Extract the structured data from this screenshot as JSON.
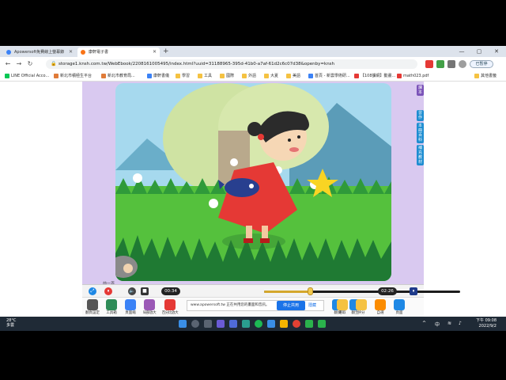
{
  "browser": {
    "tabs": [
      {
        "label": "Apowersoft免費線上螢幕錄",
        "favicon_color": "#3b82f6"
      },
      {
        "label": "康軒電子書",
        "favicon_color": "#f97316"
      }
    ],
    "new_tab": "+",
    "window_controls": [
      "—",
      "▢",
      "✕"
    ],
    "url": "storage1.knsh.com.tw/WebEbook/2208161005495/index.html?uuid=31188965-395d-41b0-a7af-61d2c6c07d38&openby=knsh",
    "pause_button": "已暫停",
    "bookmarks": [
      {
        "label": "LINE Official Acco...",
        "color": "#06c755"
      },
      {
        "label": "新北市積極生平台",
        "color": "#e07b39"
      },
      {
        "label": "新北市教育局...",
        "color": "#e07b39"
      },
      {
        "label": "康軒書儀",
        "color": "#3b82f6"
      },
      {
        "label": "學習",
        "color": "#f5c242"
      },
      {
        "label": "工具",
        "color": "#f5c242"
      },
      {
        "label": "國際",
        "color": "#f5c242"
      },
      {
        "label": "外語",
        "color": "#f5c242"
      },
      {
        "label": "大夏",
        "color": "#f5c242"
      },
      {
        "label": "美語",
        "color": "#f5c242"
      },
      {
        "label": "首頁 - 新雲學術研...",
        "color": "#3b82f6"
      },
      {
        "label": "【108課綱】動畫...",
        "color": "#e53935"
      },
      {
        "label": "math023.pdf",
        "color": "#e53935"
      },
      {
        "label": "其他書籤",
        "color": "#f5c242"
      }
    ]
  },
  "ebook": {
    "side_tabs": [
      "課本",
      "習作",
      "本冊百科",
      "補充教材"
    ],
    "prev_label": "前一頁",
    "player": {
      "current_time": "00:34",
      "total_time": "02:26",
      "progress": 0.233
    },
    "tools": [
      {
        "label": "翻頁設定",
        "color": "#555"
      },
      {
        "label": "工具箱",
        "color": "#2e8b57"
      },
      {
        "label": "頁面縮",
        "color": "#3b82f6"
      },
      {
        "label": "局部放大",
        "color": "#9b59b6"
      },
      {
        "label": "百分比放大",
        "color": "#e53935"
      },
      {
        "label": "翻頁",
        "color": "#1e88e5"
      },
      {
        "label": "翻至",
        "color": "#1e88e5"
      },
      {
        "label": "選取",
        "color": "#f5c242"
      },
      {
        "label": "評分",
        "color": "#f5c242"
      },
      {
        "label": "自選",
        "color": "#fb8c00"
      },
      {
        "label": "頁面",
        "color": "#1e88e5"
      }
    ],
    "notification": {
      "text": "www.apowersoft.tw 正在共用您的畫面和音訊。",
      "stop_label": "停止共用",
      "hide_label": "隱藏"
    }
  },
  "taskbar": {
    "weather_temp": "28°C",
    "weather_desc": "多雲",
    "time": "下午 09:08",
    "date": "2022/9/2",
    "ime": "中"
  }
}
